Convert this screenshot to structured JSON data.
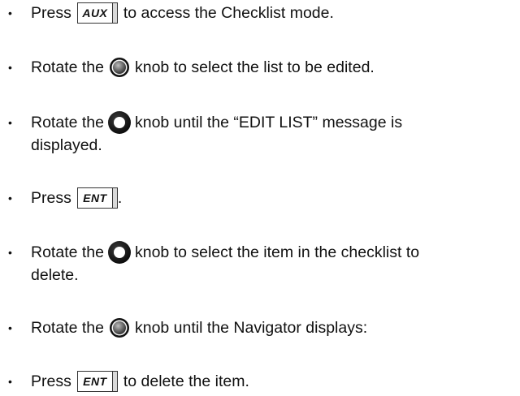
{
  "bullet_char": "•",
  "keys": {
    "aux": "AUX",
    "ent": "ENT"
  },
  "steps": [
    {
      "pre": "Press",
      "post": "to access the Checklist mode."
    },
    {
      "pre": "Rotate the",
      "post": "knob to select the list to be edited."
    },
    {
      "pre": "Rotate the",
      "post": "knob until the “EDIT LIST” message is",
      "line2": "displayed."
    },
    {
      "pre": "Press",
      "post": "."
    },
    {
      "pre": "Rotate the",
      "post": "knob to select the item in the checklist to",
      "line2": "delete."
    },
    {
      "pre": "Rotate the",
      "post": "knob until the Navigator displays:"
    },
    {
      "pre": "Press",
      "post": "to delete the item."
    }
  ],
  "icons": {
    "inner_knob": "knob-inner-icon",
    "outer_knob": "knob-outer-icon"
  }
}
